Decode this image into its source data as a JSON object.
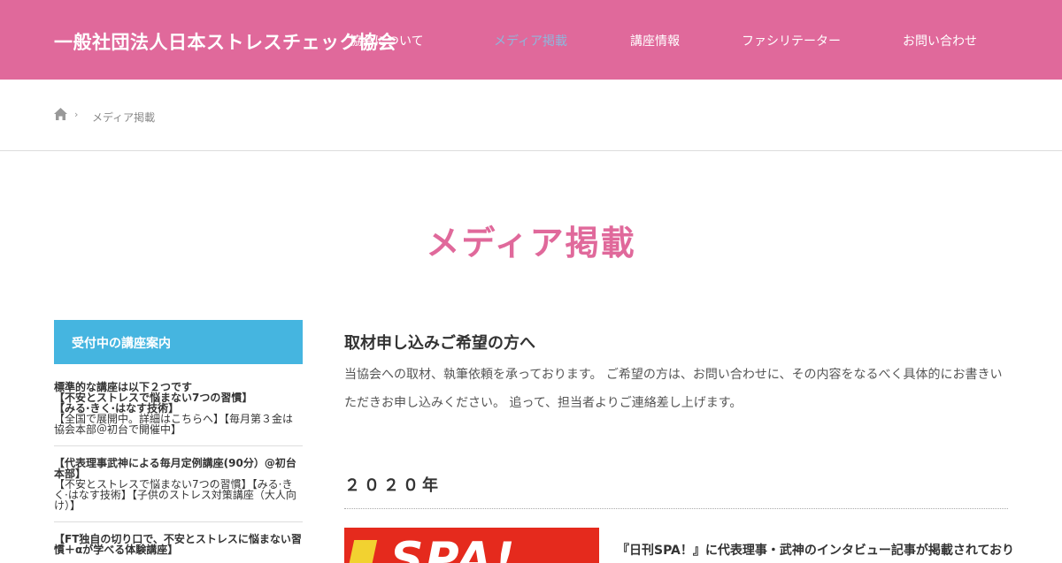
{
  "header": {
    "site_title": "一般社団法人日本ストレスチェック協会",
    "nav": [
      {
        "label": "協会について"
      },
      {
        "label": "メディア掲載"
      },
      {
        "label": "講座情報"
      },
      {
        "label": "ファシリテーター"
      },
      {
        "label": "お問い合わせ"
      }
    ]
  },
  "breadcrumb": {
    "home_icon": "home-icon",
    "separator": "›",
    "current": "メディア掲載"
  },
  "page_title": "メディア掲載",
  "sidebar": {
    "heading": "受付中の講座案内",
    "entries": [
      {
        "title": "標準的な講座は以下２つです\n【不安とストレスで悩まない7つの習慣】\n【みる·きく·はなす技術】",
        "detail": "【全国で展開中。詳細はこちらへ】【毎月第３金は協会本部＠初台で開催中】"
      },
      {
        "title": "【代表理事武神による毎月定例講座(90分）@初台本部】",
        "detail": "【不安とストレスで悩まない7つの習慣】【みる·きく·はなす技術】【子供のストレス対策講座（大人向け）】"
      },
      {
        "title": "【FT独自の切り口で、不安とストレスに悩まない習慣＋αが学べる体験講座】",
        "detail": ""
      }
    ]
  },
  "content": {
    "subheading": "取材申し込みご希望の方へ",
    "body_line1": "当協会への取材、執筆依頼を承っております。 ご希望の方は、お問い合わせに、その内容をなるべく具体的にお書きい",
    "body_line2": "ただきお申し込みください。 追って、担当者よりご連絡差し上げます。",
    "year": "２０２０年",
    "article": {
      "thumb_text": "SPA!",
      "title": "『日刊SPA！』に代表理事・武神のインタビュー記事が掲載されており"
    }
  },
  "colors": {
    "header_bg": "#e0699b",
    "active_nav": "#8fb6dc",
    "sidebar_head_bg": "#45b5e0",
    "page_title": "#e0699b"
  }
}
